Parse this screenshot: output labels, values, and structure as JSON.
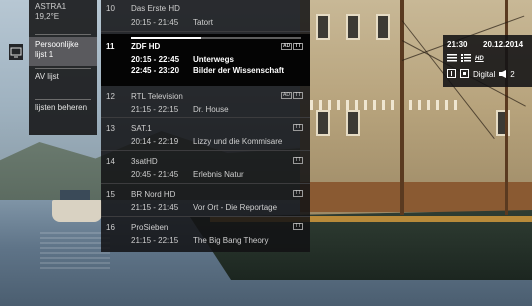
{
  "left_menu": {
    "satellite": "ASTRA1",
    "satellite_pos": "19,2°E",
    "items": [
      "Persoonlijke lijst 1",
      "AV lijst",
      "lijsten beheren"
    ],
    "selected_index": 0
  },
  "channels": [
    {
      "num": "10",
      "name": "Das Erste HD",
      "time": "20:15 - 21:45",
      "title": "Tatort",
      "progress": 0.0,
      "badges": []
    },
    {
      "num": "11",
      "name": "ZDF HD",
      "time": "20:15 - 22:45",
      "title": "Unterwegs",
      "time2": "22:45 - 23:20",
      "title2": "Bilder der Wissenschaft",
      "progress": 0.41,
      "badges": [
        "AD",
        "TT"
      ],
      "active": true
    },
    {
      "num": "12",
      "name": "RTL Television",
      "time": "21:15 - 22:15",
      "title": "Dr. House",
      "progress": 0.0,
      "badges": [
        "AD",
        "TT"
      ]
    },
    {
      "num": "13",
      "name": "SAT.1",
      "time": "20:14 - 22:19",
      "title": "Lizzy und die Kommisare",
      "progress": 0.0,
      "badges": [
        "TT"
      ]
    },
    {
      "num": "14",
      "name": "3satHD",
      "time": "20:45 - 21:45",
      "title": "Erlebnis Natur",
      "progress": 0.0,
      "badges": [
        "TT"
      ]
    },
    {
      "num": "15",
      "name": "BR Nord HD",
      "time": "21:15 - 21:45",
      "title": "Vor Ort - Die Reportage",
      "progress": 0.0,
      "badges": [
        "TT"
      ]
    },
    {
      "num": "16",
      "name": "ProSieben",
      "time": "21:15 - 22:15",
      "title": "The Big Bang Theory",
      "progress": 0.0,
      "badges": [
        "TT"
      ]
    }
  ],
  "info_panel": {
    "time": "21:30",
    "date": "20.12.2014",
    "hd_label": "HD",
    "digital_label": "Digital",
    "audio_channel": "2"
  },
  "colors": {
    "panel_bg": "#121214",
    "selected_menu_bg": "#5a5a5e",
    "active_row_bg": "#040404",
    "text": "#cfcfcf"
  }
}
